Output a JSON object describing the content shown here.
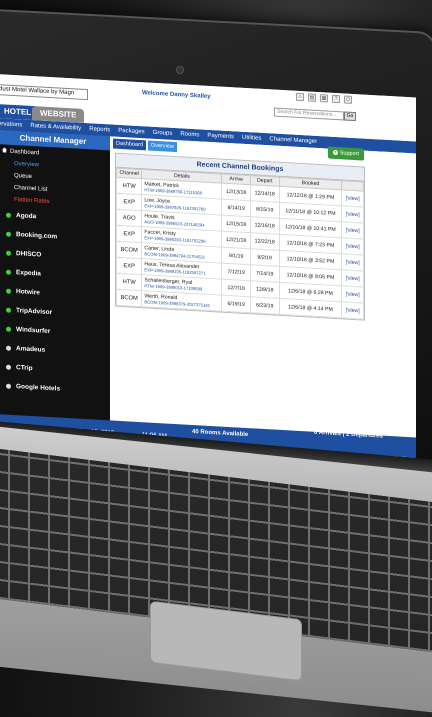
{
  "topbar": {
    "motel_select": "dust Motel Wallace by Magn",
    "welcome": "Welcome Danny Skalley",
    "search_placeholder": "Search For Reservations...",
    "go_label": "Go"
  },
  "tabs": [
    "HOTEL",
    "WEBSITE"
  ],
  "nav": [
    "ervations",
    "Rates & Availability",
    "Reports",
    "Packages",
    "Groups",
    "Rooms",
    "Payments",
    "Utilities",
    "Channel Manager"
  ],
  "sidebar": {
    "title": "Channel Manager",
    "dashboard": "Dashboard",
    "sub_items": [
      {
        "label": "Overview",
        "state": "active"
      },
      {
        "label": "Queue",
        "state": "normal"
      },
      {
        "label": "Channel List",
        "state": "normal"
      },
      {
        "label": "Flatten Rates",
        "state": "alert"
      }
    ],
    "channels": [
      "Agoda",
      "Booking.com",
      "DHISCO",
      "Expedia",
      "Hotwire",
      "TripAdvisor",
      "Windsurfer",
      "Amadeus",
      "CTrip",
      "Google Hotels"
    ]
  },
  "main": {
    "subtabs": [
      "Dashboard",
      "Overview"
    ],
    "support_label": "Support",
    "panel_title": "Recent Channel Bookings",
    "columns": [
      "Channel",
      "Details",
      "Arrive",
      "Depart",
      "Booked",
      ""
    ],
    "rows": [
      {
        "channel": "HTW",
        "name": "Market, Patrick",
        "conf": "HTW-1909-3869758-17115268",
        "arrive": "12/13/18",
        "depart": "12/14/18",
        "booked": "12/12/18 @ 1:29 PM",
        "view": "[View]"
      },
      {
        "channel": "EXP",
        "name": "Low, Joyce",
        "conf": "EXP-1909-3997926-1162291760",
        "arrive": "8/14/19",
        "depart": "8/15/19",
        "booked": "12/11/18 @ 10:12 PM",
        "view": "[View]"
      },
      {
        "channel": "AGO",
        "name": "Houle, Travis",
        "conf": "AGO-1909-3995523-237148294",
        "arrive": "12/15/18",
        "depart": "12/16/18",
        "booked": "12/10/18 @ 10:41 PM",
        "view": "[View]"
      },
      {
        "channel": "EXP",
        "name": "Faccer, Kristy",
        "conf": "EXP-1909-3995263-1161702298",
        "arrive": "12/21/18",
        "depart": "12/22/18",
        "booked": "12/10/18 @ 7:23 PM",
        "view": "[View]"
      },
      {
        "channel": "BCOM",
        "name": "Carter, Linda",
        "conf": "BCOM-1909-3994794-11754521",
        "arrive": "8/1/19",
        "depart": "8/2/19",
        "booked": "12/10/18 @ 3:52 PM",
        "view": "[View]"
      },
      {
        "channel": "EXP",
        "name": "Haus, Teresa Alexander",
        "conf": "EXP-1909-3989105-1162597271",
        "arrive": "7/12/19",
        "depart": "7/14/19",
        "booked": "12/10/18 @ 8:05 PM",
        "view": "[View]"
      },
      {
        "channel": "HTW",
        "name": "Schallenberger, Ryal",
        "conf": "HTW-1909-3989013-17109599",
        "arrive": "12/7/18",
        "depart": "12/8/18",
        "booked": "12/6/18 @ 6:28 PM",
        "view": "[View]"
      },
      {
        "channel": "BCOM",
        "name": "Werth, Ronald",
        "conf": "BCOM-1909-3988379-2027375161",
        "arrive": "6/19/19",
        "depart": "6/23/19",
        "booked": "12/6/18 @ 4:14 PM",
        "view": "[View]"
      }
    ]
  },
  "footer": {
    "node": "Node W11  |  Site: 1909  |  Wed Dec 12, 2018",
    "time": "11:06 AM",
    "rooms": "40 Rooms Available",
    "counts": "0 Arrivals  |  2 Departures"
  }
}
